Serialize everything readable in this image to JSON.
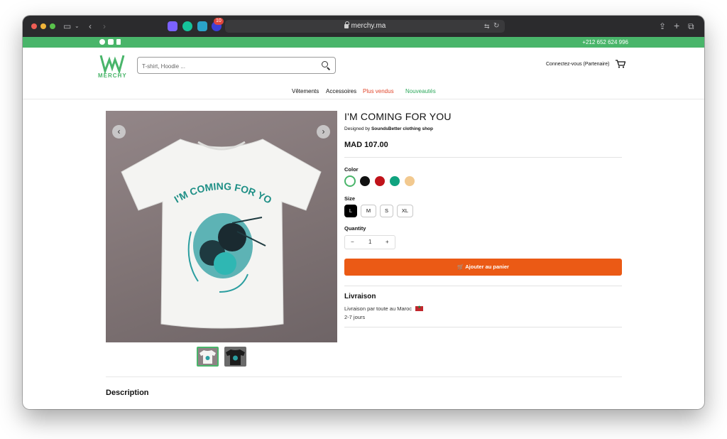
{
  "browser": {
    "url": "merchy.ma",
    "extension_badge": "10"
  },
  "topbar": {
    "phone": "+212 652 624 996",
    "social": [
      "facebook-icon",
      "instagram-icon",
      "tiktok-icon"
    ]
  },
  "header": {
    "logo_text": "MERCHY",
    "search_placeholder": "T-shirt, Hoodie ...",
    "login_label": "Connectez-vous (Partenaire)"
  },
  "nav": {
    "items": [
      "Vêtements",
      "Accessoires",
      "Plus vendus",
      "Nouveautés"
    ]
  },
  "product": {
    "title": "I'M COMING FOR YOU",
    "designed_by_prefix": "Designed by",
    "designer": "SoundsBetter clothing shop",
    "price": "MAD 107.00",
    "shirt_text": "I'M COMING FOR YOU",
    "color_label": "Color",
    "colors": [
      "#ffffff",
      "#111111",
      "#c0131a",
      "#10a37f",
      "#f2c98f"
    ],
    "size_label": "Size",
    "sizes": [
      "L",
      "M",
      "S",
      "XL"
    ],
    "selected_size": "L",
    "quantity_label": "Quantity",
    "quantity": "1",
    "minus": "−",
    "plus": "+",
    "add_to_cart": "Ajouter au panier"
  },
  "delivery": {
    "title": "Livraison",
    "line1": "Livraison par toute au Maroc",
    "line2": "2-7 jours"
  },
  "description_title": "Description",
  "colors": {
    "brand_green": "#49b56a",
    "accent_orange": "#eb5a15"
  }
}
